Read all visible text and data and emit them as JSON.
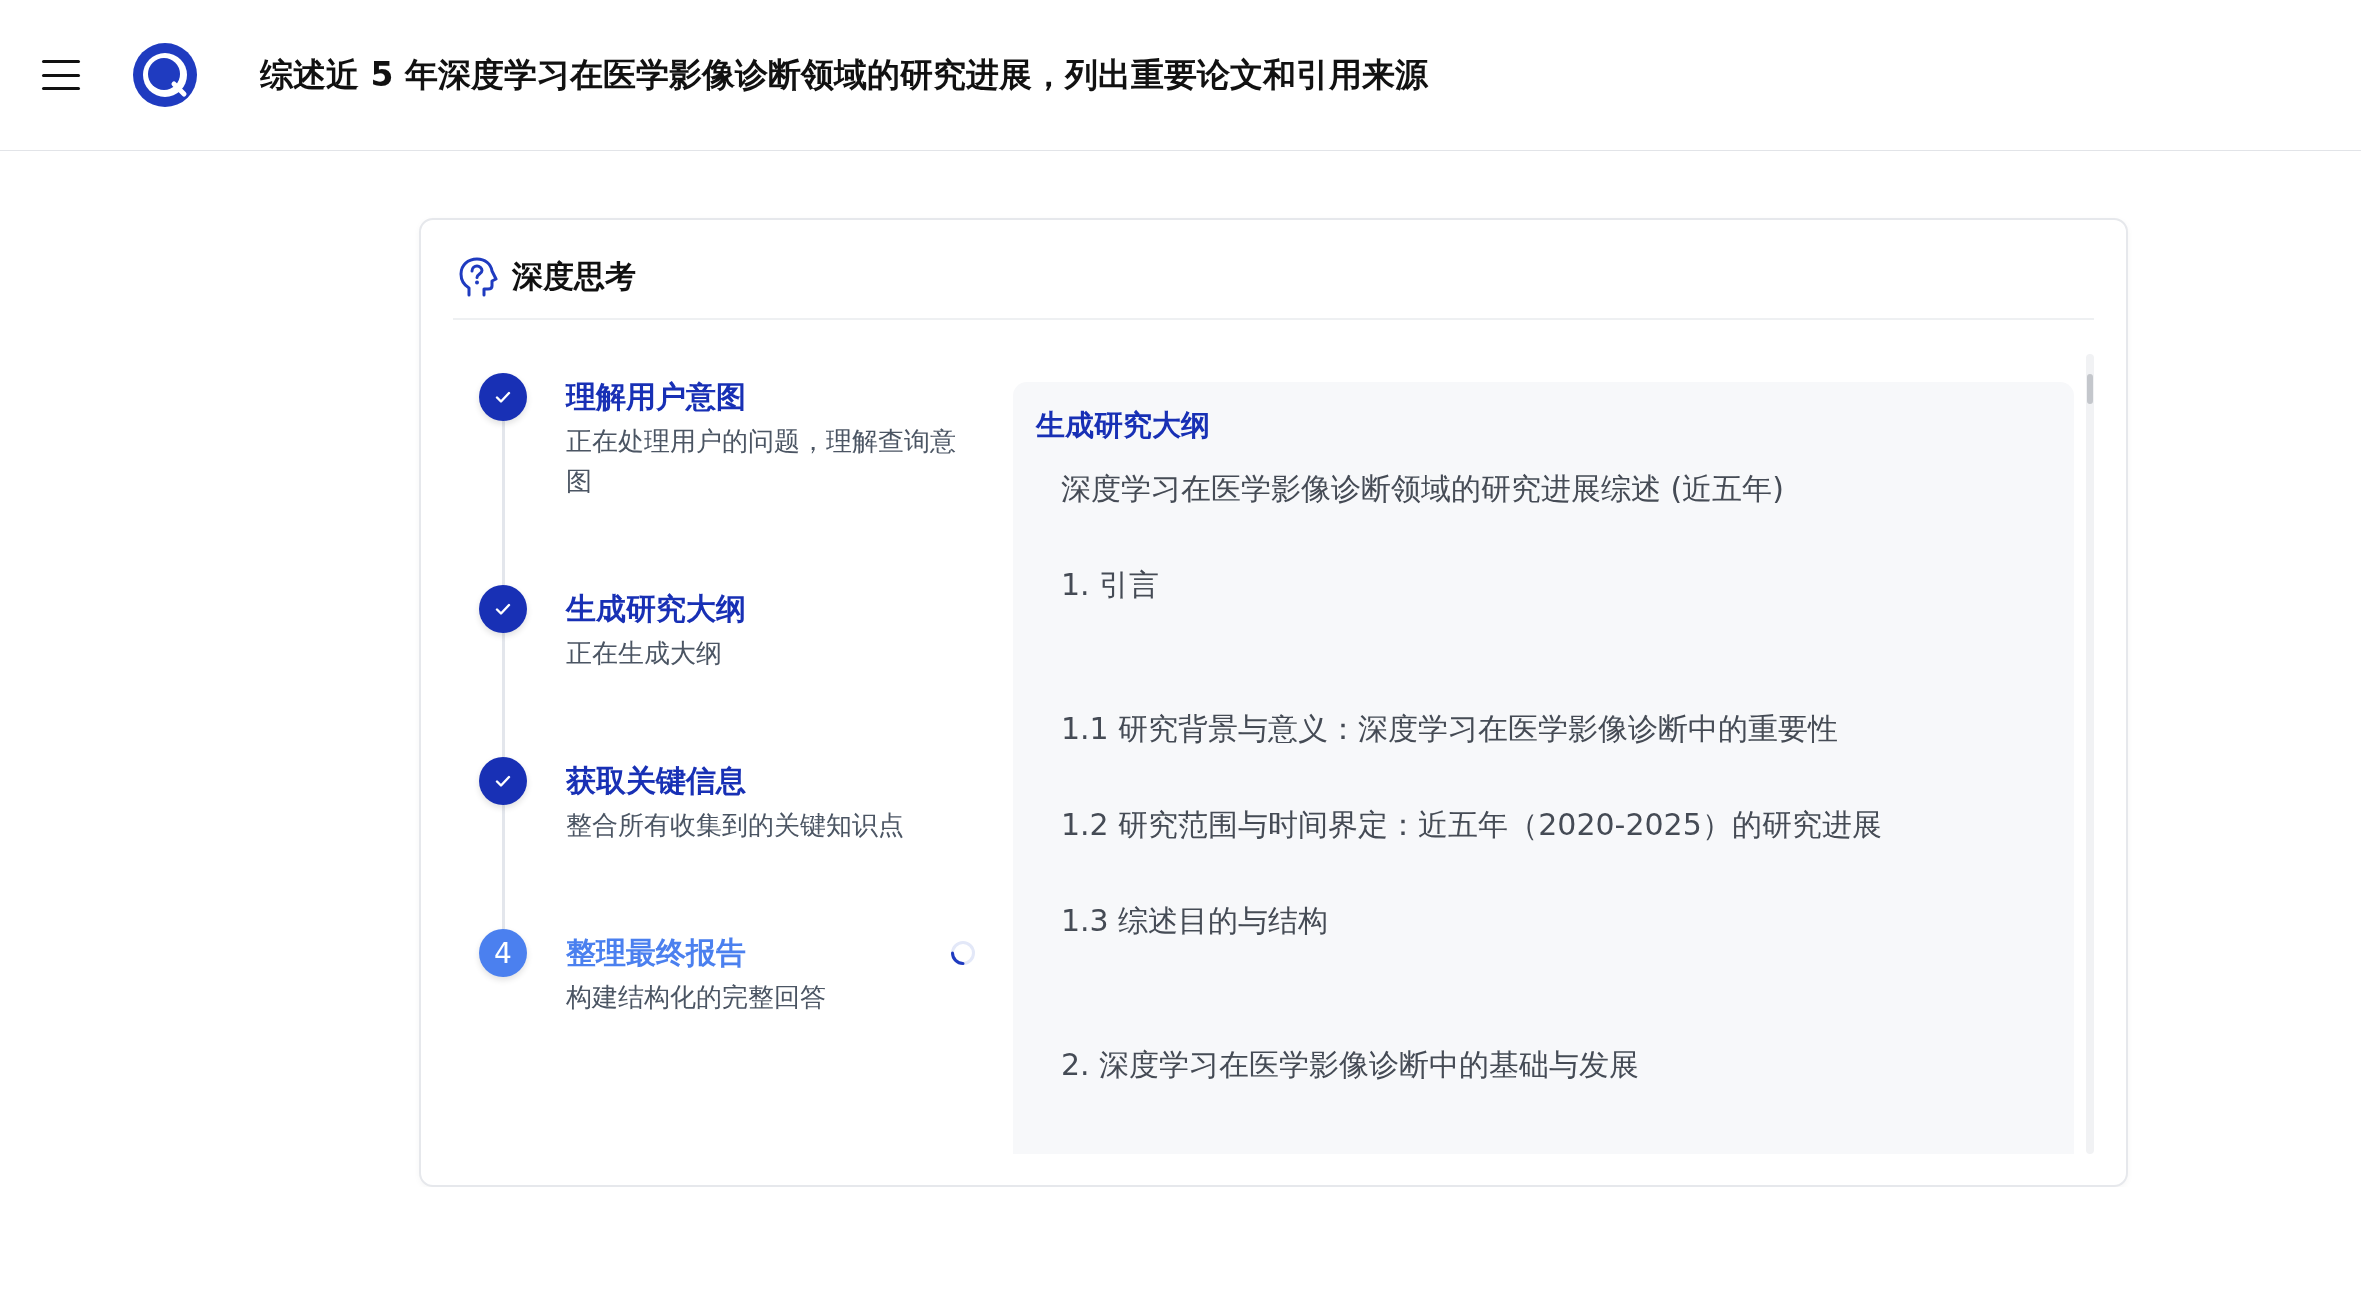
{
  "header": {
    "title": "综述近 5 年深度学习在医学影像诊断领域的研究进展，列出重要论文和引用来源"
  },
  "thinking": {
    "title": "深度思考",
    "steps": [
      {
        "title": "理解用户意图",
        "description": "正在处理用户的问题，理解查询意图",
        "done": true,
        "active": false
      },
      {
        "title": "生成研究大纲",
        "description": "正在生成大纲",
        "done": true,
        "active": false
      },
      {
        "title": "获取关键信息",
        "description": "整合所有收集到的关键知识点",
        "done": true,
        "active": false
      },
      {
        "title": "整理最终报告",
        "description": "构建结构化的完整回答",
        "done": false,
        "active": true,
        "marker": "4"
      }
    ]
  },
  "outline": {
    "title": "生成研究大纲",
    "lines": [
      {
        "kind": "title",
        "text": "深度学习在医学影像诊断领域的研究进展综述 (近五年)"
      },
      {
        "kind": "section",
        "text": "1. 引言"
      },
      {
        "kind": "item",
        "text": "1.1 研究背景与意义：深度学习在医学影像诊断中的重要性"
      },
      {
        "kind": "item",
        "text": "1.2 研究范围与时间界定：近五年（2020-2025）的研究进展"
      },
      {
        "kind": "item",
        "text": "1.3 综述目的与结构"
      },
      {
        "kind": "section",
        "text": "2. 深度学习在医学影像诊断中的基础与发展"
      }
    ]
  }
}
